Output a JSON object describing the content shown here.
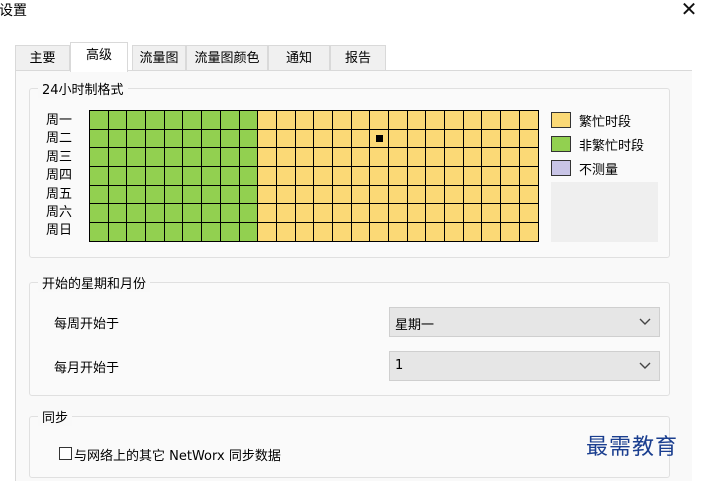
{
  "window": {
    "title": "设置"
  },
  "tabs": [
    {
      "label": "主要"
    },
    {
      "label": "高级"
    },
    {
      "label": "流量图"
    },
    {
      "label": "流量图颜色"
    },
    {
      "label": "通知"
    },
    {
      "label": "报告"
    }
  ],
  "active_tab": "高级",
  "schedule": {
    "title": "24小时制格式",
    "days": [
      "周一",
      "周二",
      "周三",
      "周四",
      "周五",
      "周六",
      "周日"
    ],
    "hours_per_day": 24,
    "free_hours": 9,
    "selected_cell": {
      "day": "周二",
      "hour": 15
    },
    "legend": [
      {
        "label": "繁忙时段",
        "color": "#fbd976"
      },
      {
        "label": "非繁忙时段",
        "color": "#92d050"
      },
      {
        "label": "不测量",
        "color": "#c8c4e6"
      }
    ]
  },
  "week_month": {
    "title": "开始的星期和月份",
    "week_start_label": "每周开始于",
    "week_start_value": "星期一",
    "month_start_label": "每月开始于",
    "month_start_value": "1"
  },
  "sync": {
    "title": "同步",
    "checkbox_label": "与网络上的其它 NetWorx 同步数据",
    "checked": false
  },
  "watermark": "最需教育"
}
